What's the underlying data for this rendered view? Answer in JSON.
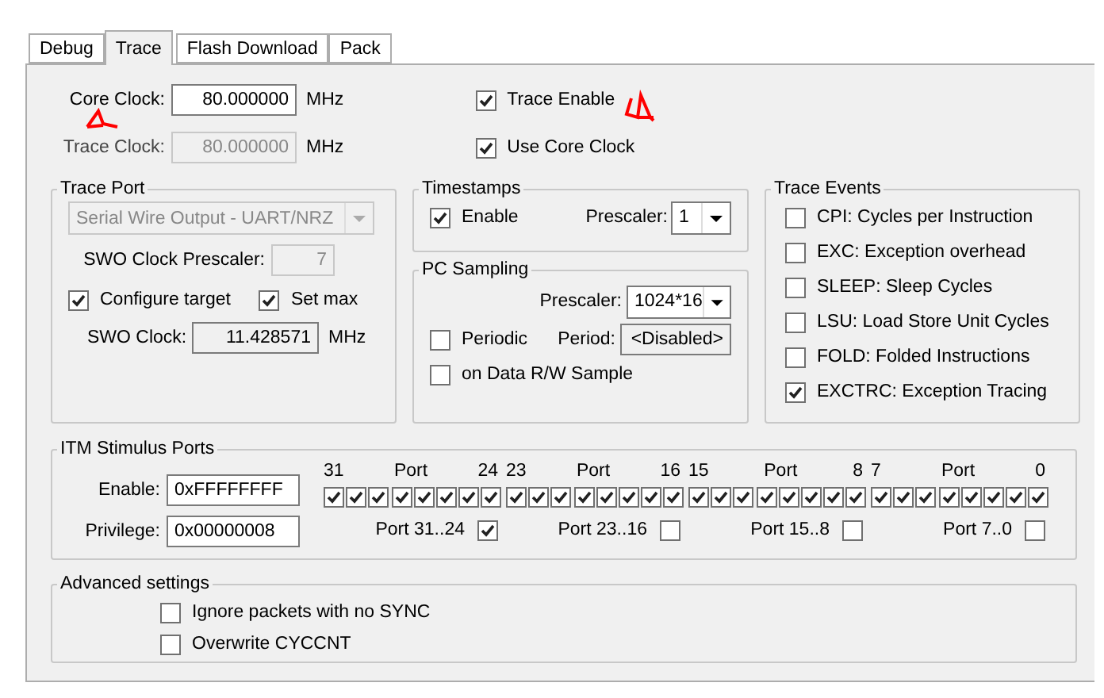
{
  "tabs": [
    {
      "label": "Debug",
      "selected": false
    },
    {
      "label": "Trace",
      "selected": true
    },
    {
      "label": "Flash Download",
      "selected": false
    },
    {
      "label": "Pack",
      "selected": false
    }
  ],
  "clocks": [
    {
      "label": "Core Clock:",
      "value": "80.000000",
      "unit": "MHz",
      "disabled": false,
      "option": {
        "label": "Trace Enable",
        "checked": true
      }
    },
    {
      "label": "Trace Clock:",
      "value": "80.000000",
      "unit": "MHz",
      "disabled": true,
      "option": {
        "label": "Use Core Clock",
        "checked": true
      }
    }
  ],
  "trace_port": {
    "title": "Trace Port",
    "mode": {
      "value": "Serial Wire Output - UART/NRZ",
      "disabled": true
    },
    "swo_prescaler": {
      "label": "SWO Clock Prescaler:",
      "value": "7",
      "disabled": true
    },
    "configure_target": {
      "label": "Configure target",
      "checked": true
    },
    "set_max": {
      "label": "Set max",
      "checked": true
    },
    "swo_clock": {
      "label": "SWO Clock:",
      "value": "11.428571",
      "unit": "MHz",
      "disabled": false
    }
  },
  "timestamps": {
    "title": "Timestamps",
    "enable": {
      "label": "Enable",
      "checked": true
    },
    "prescaler": {
      "label": "Prescaler:",
      "value": "1"
    }
  },
  "pc_sampling": {
    "title": "PC Sampling",
    "prescaler": {
      "label": "Prescaler:",
      "value": "1024*16"
    },
    "periodic": {
      "label": "Periodic",
      "checked": false
    },
    "period": {
      "label": "Period:",
      "value": "<Disabled>",
      "disabled": false
    },
    "on_data_rw": {
      "label": "on Data R/W Sample",
      "checked": false
    }
  },
  "trace_events": {
    "title": "Trace Events",
    "items": [
      {
        "label": "CPI: Cycles per Instruction",
        "checked": false
      },
      {
        "label": "EXC: Exception overhead",
        "checked": false
      },
      {
        "label": "SLEEP: Sleep Cycles",
        "checked": false
      },
      {
        "label": "LSU: Load Store Unit Cycles",
        "checked": false
      },
      {
        "label": "FOLD: Folded Instructions",
        "checked": false
      },
      {
        "label": "EXCTRC: Exception Tracing",
        "checked": true
      }
    ]
  },
  "itm": {
    "title": "ITM Stimulus Ports",
    "fields": [
      {
        "label": "Enable:",
        "value": "0xFFFFFFFF"
      },
      {
        "label": "Privilege:",
        "value": "0x00000008"
      }
    ],
    "groups": [
      {
        "high": "31",
        "label": "Port",
        "low": "24",
        "bits": [
          true,
          true,
          true,
          true,
          true,
          true,
          true,
          true
        ],
        "privilege": {
          "label": "Port 31..24",
          "checked": true
        }
      },
      {
        "high": "23",
        "label": "Port",
        "low": "16",
        "bits": [
          true,
          true,
          true,
          true,
          true,
          true,
          true,
          true
        ],
        "privilege": {
          "label": "Port 23..16",
          "checked": false
        }
      },
      {
        "high": "15",
        "label": "Port",
        "low": "8",
        "bits": [
          true,
          true,
          true,
          true,
          true,
          true,
          true,
          true
        ],
        "privilege": {
          "label": "Port 15..8",
          "checked": false
        }
      },
      {
        "high": "7",
        "label": "Port",
        "low": "0",
        "bits": [
          true,
          true,
          true,
          true,
          true,
          true,
          true,
          true
        ],
        "privilege": {
          "label": "Port 7..0",
          "checked": false
        }
      }
    ]
  },
  "advanced": {
    "title": "Advanced settings",
    "items": [
      {
        "label": "Ignore packets with no SYNC",
        "checked": false
      },
      {
        "label": "Overwrite CYCCNT",
        "checked": false
      }
    ]
  }
}
